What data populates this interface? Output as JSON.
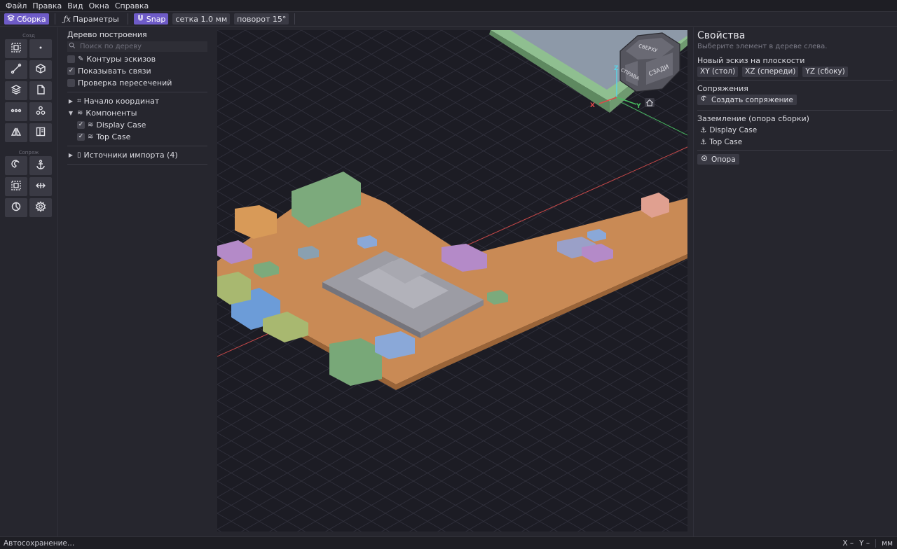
{
  "menu": [
    "Файл",
    "Правка",
    "Вид",
    "Окна",
    "Справка"
  ],
  "toolbar": {
    "assembly": "Сборка",
    "params": "Параметры",
    "snap": "Snap",
    "grid": "сетка 1.0 мм",
    "rotation": "поворот 15°"
  },
  "toolbox": {
    "section_create": "Созд",
    "section_mates": "Сопряж"
  },
  "tree": {
    "title": "Дерево построения",
    "search_placeholder": "Поиск по дереву",
    "opt_sketch_contours": "Контуры эскизов",
    "opt_show_links": "Показывать связи",
    "opt_check_intersections": "Проверка пересечений",
    "origin": "Начало координат",
    "components": "Компоненты",
    "comp_1": "Display Case",
    "comp_2": "Top Case",
    "import_sources": "Источники импорта (4)"
  },
  "viewcube": {
    "face_top": "СВЕРХУ",
    "face_right": "СПРАВА",
    "face_back": "СЗАДИ",
    "axis_x": "X",
    "axis_y": "Y",
    "axis_z": "Z"
  },
  "props": {
    "title": "Свойства",
    "hint": "Выберите элемент в дереве слева.",
    "new_sketch": "Новый эскиз на плоскости",
    "plane_xy": "XY (стол)",
    "plane_xz": "XZ (спереди)",
    "plane_yz": "YZ (сбоку)",
    "mates": "Сопряжения",
    "create_mate": "Создать сопряжение",
    "grounding": "Заземление (опора сборки)",
    "ground_1": "Display Case",
    "ground_2": "Top Case",
    "support": "Опора"
  },
  "status": {
    "autosave": "Автосохранение…",
    "x": "X –",
    "y": "Y –",
    "units": "мм"
  },
  "colors": {
    "accent": "#6e5bc7",
    "pcb": "#c98a55",
    "case_green": "#7aa67c"
  }
}
